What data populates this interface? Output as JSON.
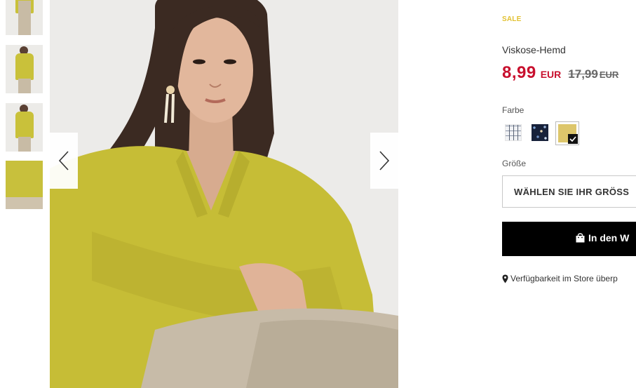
{
  "gallery": {
    "thumbnails": [
      "thumbnail-1",
      "thumbnail-2",
      "thumbnail-3",
      "thumbnail-4"
    ],
    "prev_icon": "chevron-left-icon",
    "next_icon": "chevron-right-icon"
  },
  "product": {
    "badge": "SALE",
    "name": "Viskose-Hemd",
    "price_current": "8,99",
    "price_current_currency": "EUR",
    "price_old": "17,99",
    "price_old_currency": "EUR"
  },
  "color": {
    "label": "Farbe",
    "swatches": [
      "white-check",
      "navy-floral",
      "yellow"
    ],
    "selected": "yellow"
  },
  "size": {
    "label": "Größe",
    "placeholder": "WÄHLEN SIE IHR GRÖSS"
  },
  "cart": {
    "label": "In den W",
    "icon": "shopping-bag-icon"
  },
  "store": {
    "label": "Verfügbarkeit im Store überp",
    "icon": "map-pin-icon"
  },
  "colors": {
    "sale": "#e2c131",
    "price": "#c8102e",
    "button_bg": "#000000"
  }
}
